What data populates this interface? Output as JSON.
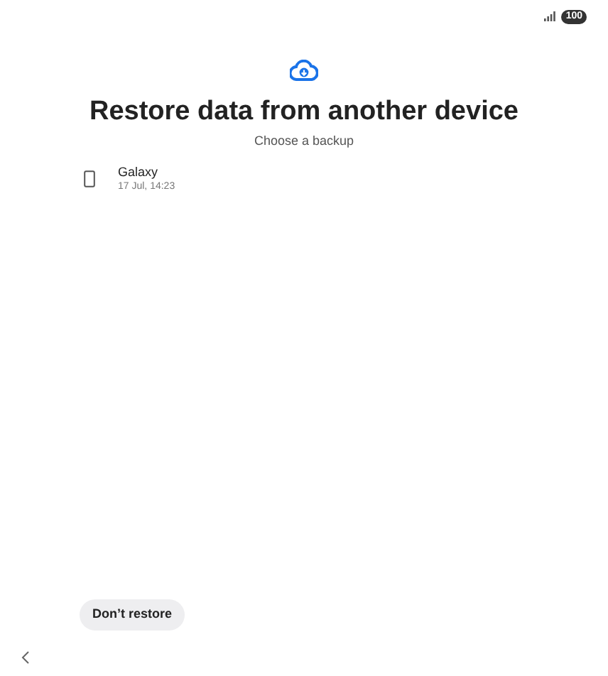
{
  "status_bar": {
    "battery": "100"
  },
  "title": "Restore data from another device",
  "subtitle": "Choose a backup",
  "backups": [
    {
      "name": "Galaxy",
      "date": "17 Jul, 14:23"
    }
  ],
  "buttons": [
    "Don’t restore"
  ]
}
